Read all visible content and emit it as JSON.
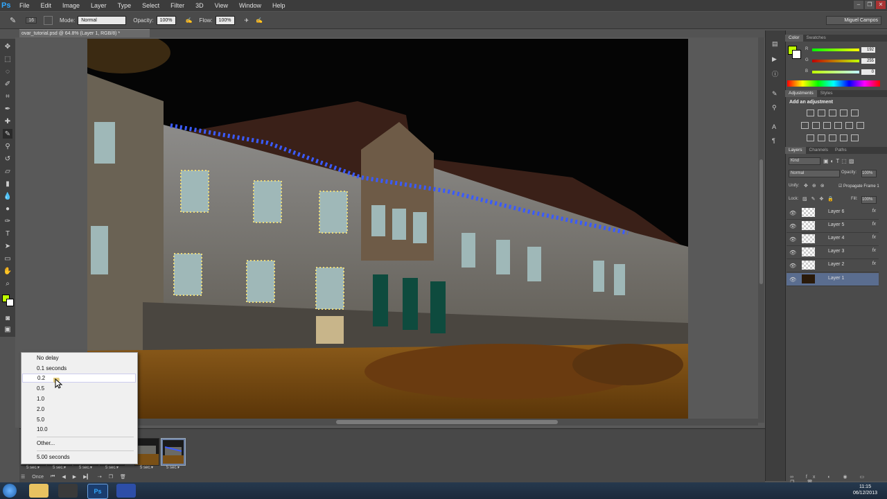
{
  "app": {
    "logo": "Ps"
  },
  "menu": [
    "File",
    "Edit",
    "Image",
    "Layer",
    "Type",
    "Select",
    "Filter",
    "3D",
    "View",
    "Window",
    "Help"
  ],
  "options": {
    "brush_size": "16",
    "mode_label": "Mode:",
    "mode_value": "Normal",
    "opacity_label": "Opacity:",
    "opacity_value": "100%",
    "flow_label": "Flow:",
    "flow_value": "100%",
    "workspace": "Miguel Campos"
  },
  "document": {
    "tab_title": "ovar_tutorial.psd @ 64.8% (Layer 1, RGB/8) *"
  },
  "delay_menu": {
    "items": [
      "No delay",
      "0.1 seconds",
      "0.2",
      "0.5",
      "1.0",
      "2.0",
      "5.0",
      "10.0"
    ],
    "highlighted_index": 2,
    "other": "Other...",
    "current": "5.00 seconds"
  },
  "timeline": {
    "frames": [
      {
        "delay": "5 sec.▾"
      },
      {
        "delay": "5 sec.▾"
      },
      {
        "delay": "5 sec.▾"
      },
      {
        "delay": "5 sec.▾"
      },
      {
        "delay": "5 sec.▾"
      },
      {
        "delay": "5 sec.▾"
      }
    ],
    "loop": "Once"
  },
  "color_panel": {
    "tabs": [
      "Color",
      "Swatches"
    ],
    "r_label": "R",
    "g_label": "G",
    "b_label": "B",
    "r_value": "192",
    "g_value": "255",
    "b_value": "0",
    "foreground": "#c0ff00"
  },
  "adjustments_panel": {
    "tabs": [
      "Adjustments",
      "Styles"
    ],
    "heading": "Add an adjustment"
  },
  "layers_panel": {
    "tabs": [
      "Layers",
      "Channels",
      "Paths"
    ],
    "kind": "Kind",
    "blend": "Normal",
    "opacity_label": "Opacity:",
    "opacity_value": "100%",
    "unify_label": "Unify:",
    "propagate": "Propagate Frame 1",
    "lock_label": "Lock:",
    "fill_label": "Fill:",
    "fill_value": "100%",
    "layers": [
      {
        "name": "Layer 6",
        "fx": "fx"
      },
      {
        "name": "Layer 5",
        "fx": "fx"
      },
      {
        "name": "Layer 4",
        "fx": "fx"
      },
      {
        "name": "Layer 3",
        "fx": "fx"
      },
      {
        "name": "Layer 2",
        "fx": "fx"
      },
      {
        "name": "Layer 1",
        "fx": ""
      }
    ],
    "selected_layer": "Layer 1"
  },
  "clock": {
    "time": "11:15",
    "date": "06/12/2013"
  }
}
